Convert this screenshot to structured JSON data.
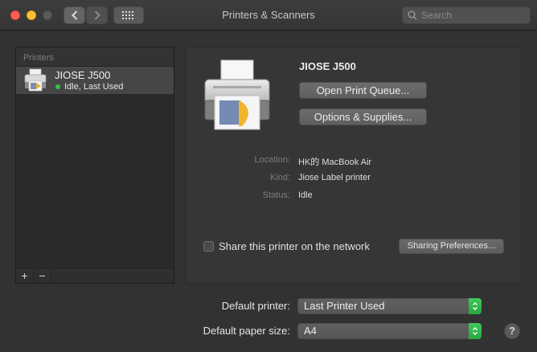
{
  "window": {
    "title": "Printers & Scanners"
  },
  "toolbar": {
    "back_icon": "chevron-left-icon",
    "forward_icon": "chevron-right-icon",
    "grid_icon": "grid-icon"
  },
  "search": {
    "placeholder": "Search"
  },
  "printers_list": {
    "header": "Printers",
    "items": [
      {
        "name": "JIOSE J500",
        "status": "Idle, Last Used",
        "status_color": "#31c54a"
      }
    ],
    "add_label": "+",
    "remove_label": "−"
  },
  "detail": {
    "printer_name": "JIOSE J500",
    "open_queue_label": "Open Print Queue...",
    "options_label": "Options & Supplies...",
    "location_key": "Location:",
    "location_value": "HK的 MacBook Air",
    "kind_key": "Kind:",
    "kind_value": "Jiose Label printer",
    "status_key": "Status:",
    "status_value": "Idle",
    "share_label": "Share this printer on the network",
    "share_checked": false,
    "sharing_prefs_label": "Sharing Preferences..."
  },
  "defaults": {
    "printer_label": "Default printer:",
    "printer_value": "Last Printer Used",
    "paper_label": "Default paper size:",
    "paper_value": "A4"
  },
  "help": {
    "label": "?"
  },
  "colors": {
    "accent_green": "#31c54a",
    "close": "#ff5f57",
    "minimize": "#febc2e"
  }
}
